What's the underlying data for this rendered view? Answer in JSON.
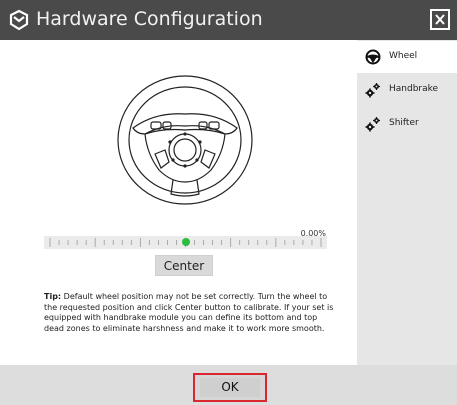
{
  "window": {
    "title": "Hardware Configuration",
    "close_icon": "close-icon",
    "logo_icon": "logo-icon"
  },
  "sidebar": {
    "items": [
      {
        "label": "Wheel",
        "icon": "steering-wheel-icon",
        "active": true
      },
      {
        "label": "Handbrake",
        "icon": "gears-icon",
        "active": false
      },
      {
        "label": "Shifter",
        "icon": "gears-icon",
        "active": false
      }
    ]
  },
  "wheel_panel": {
    "position_value": "0.00%",
    "position_fraction": 0.5,
    "center_button": "Center",
    "tip_label": "Tip:",
    "tip_text": " Default wheel position may not be set correctly. Turn the wheel to the requested position and click Center button to calibrate. If your set is equipped with handbrake module you can define its bottom and top dead zones to eliminate harshness and make it to work more smooth."
  },
  "footer": {
    "ok_button": "OK"
  },
  "colors": {
    "titlebar": "#4a4a4a",
    "sidebar": "#e6e6e6",
    "slider_thumb": "#2bbd3b",
    "ok_highlight": "#d9262f"
  }
}
